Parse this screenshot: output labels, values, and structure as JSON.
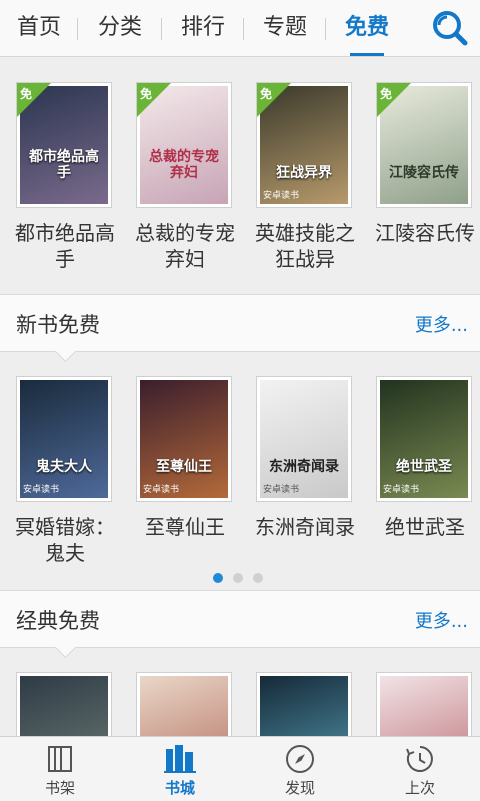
{
  "nav": {
    "tabs": [
      {
        "label": "首页"
      },
      {
        "label": "分类"
      },
      {
        "label": "排行"
      },
      {
        "label": "专题"
      },
      {
        "label": "免费",
        "active": true
      }
    ],
    "search_icon": "search-icon"
  },
  "featured": {
    "badge": "免",
    "books": [
      {
        "title": "都市绝品高手",
        "cover_text": "都市绝品高手",
        "cover_colors": [
          "#2b3650",
          "#7a6a8c"
        ]
      },
      {
        "title": "总裁的专宠弃妇",
        "cover_text": "总裁的专宠弃妇",
        "cover_colors": [
          "#f3e9ea",
          "#c7a4b5"
        ]
      },
      {
        "title": "英雄技能之狂战异",
        "cover_text": "狂战异界",
        "cover_colors": [
          "#3a3a2c",
          "#b79a6b"
        ]
      },
      {
        "title": "江陵容氏传",
        "cover_text": "江陵容氏传",
        "cover_colors": [
          "#e8eadc",
          "#8fa08a"
        ]
      }
    ]
  },
  "new_free": {
    "title": "新书免费",
    "more": "更多...",
    "books": [
      {
        "title": "冥婚错嫁：鬼夫",
        "cover_text": "鬼夫大人",
        "cover_colors": [
          "#1a2b3c",
          "#4f6a9a"
        ]
      },
      {
        "title": "至尊仙王",
        "cover_text": "至尊仙王",
        "cover_colors": [
          "#3b1e2d",
          "#b46a3a"
        ]
      },
      {
        "title": "东洲奇闻录",
        "cover_text": "东洲奇闻录",
        "cover_colors": [
          "#f2f2f2",
          "#c9c9c9"
        ]
      },
      {
        "title": "绝世武圣",
        "cover_text": "绝世武圣",
        "cover_colors": [
          "#22331f",
          "#7a8a52"
        ]
      }
    ],
    "cover_footer": "安卓读书",
    "pager": {
      "count": 3,
      "active": 1
    }
  },
  "classic_free": {
    "title": "经典免费",
    "more": "更多...",
    "books": [
      {
        "cover_colors": [
          "#2f3b45",
          "#6f7f7a"
        ]
      },
      {
        "cover_colors": [
          "#e9d7c8",
          "#b16a5a"
        ]
      },
      {
        "cover_colors": [
          "#152a38",
          "#5aa0b8"
        ]
      },
      {
        "cover_colors": [
          "#f1e3e6",
          "#b96a70"
        ]
      }
    ]
  },
  "bottom_nav": [
    {
      "label": "书架",
      "icon": "bookshelf-icon"
    },
    {
      "label": "书城",
      "icon": "bookstore-icon",
      "active": true
    },
    {
      "label": "发现",
      "icon": "compass-icon"
    },
    {
      "label": "上次",
      "icon": "history-icon"
    }
  ],
  "colors": {
    "accent": "#1478c8",
    "badge_green": "#6ab437"
  }
}
